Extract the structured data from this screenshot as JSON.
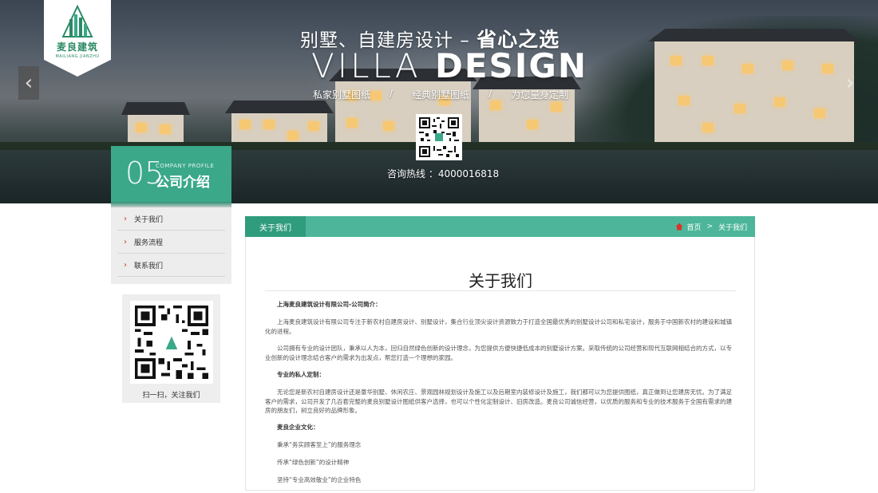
{
  "brand": {
    "name_cn": "麦良建筑",
    "name_en": "MAILIANG JIANZHU"
  },
  "hero": {
    "subtitle_prefix": "别墅、自建房设计 – ",
    "subtitle_bold": "省心之选",
    "title_light": "VILLA ",
    "title_bold": "DESIGN",
    "tags": [
      "私家别墅图纸",
      "经典别墅图纸",
      "为您量身定制"
    ],
    "tag_separator": "/",
    "hotline": "咨询热线 ：4000016818",
    "prev_arrow": "‹",
    "next_arrow": "›"
  },
  "sidebar": {
    "section_number": "05",
    "section_en": "COMPANY PROFILE",
    "section_cn": "公司介绍",
    "items": [
      {
        "label": "关于我们"
      },
      {
        "label": "服务流程"
      },
      {
        "label": "联系我们"
      }
    ],
    "chevron": "›",
    "qr_caption": "扫一扫，关注我们"
  },
  "main": {
    "tab_label": "关于我们",
    "breadcrumb": {
      "home": "首页",
      "separator": ">",
      "current": "关于我们"
    },
    "page_title": "关于我们",
    "article": {
      "intro_heading": "上海麦良建筑设计有限公司-公司简介：",
      "intro_text": "上海麦良建筑设计有限公司专注于新农村自建房设计、别墅设计，集合行业顶尖设计资源致力于打造全国最优秀的别墅设计公司和私宅设计，服务于中国新农村的建设和城镇化的进程。",
      "team_text": "公司拥有专业的设计团队，秉承以人为本，回归自然绿色创新的设计理念，为您提供方便快捷低成本的别墅设计方案。采取传统的公司经营和现代互联网相结合的方式，以专业创新的设计理念结合客户的需求为出发点，帮您打造一个理想的家园。",
      "custom_heading": "专业的私人定制：",
      "custom_text": "无论您是新农村自建房设计还是豪华别墅、休闲农庄、景观园林规划设计及施工以及后期室内装修设计及施工，我们都可以为您提供图纸，真正做到让您建房无忧。为了满足客户的需求，公司开发了几百套完整的麦良别墅设计图纸供客户选择，也可以个性化定制设计、旧房改造。麦良公司诚信经营，以优质的服务和专业的技术服务于全国有需求的建房的朋友们，树立良好的品牌形象。",
      "culture_heading": "麦良企业文化：",
      "culture_lines": [
        "秉承“务实顾客至上”的服务理念",
        "传承“绿色创新”的设计精神",
        "坚持“专业高效敬业”的企业特色"
      ]
    }
  },
  "colors": {
    "brand_green": "#3aa889",
    "tab_bar": "#4db69a",
    "tab_active": "#2f9c7d",
    "chevron_red": "#c23a2b"
  }
}
